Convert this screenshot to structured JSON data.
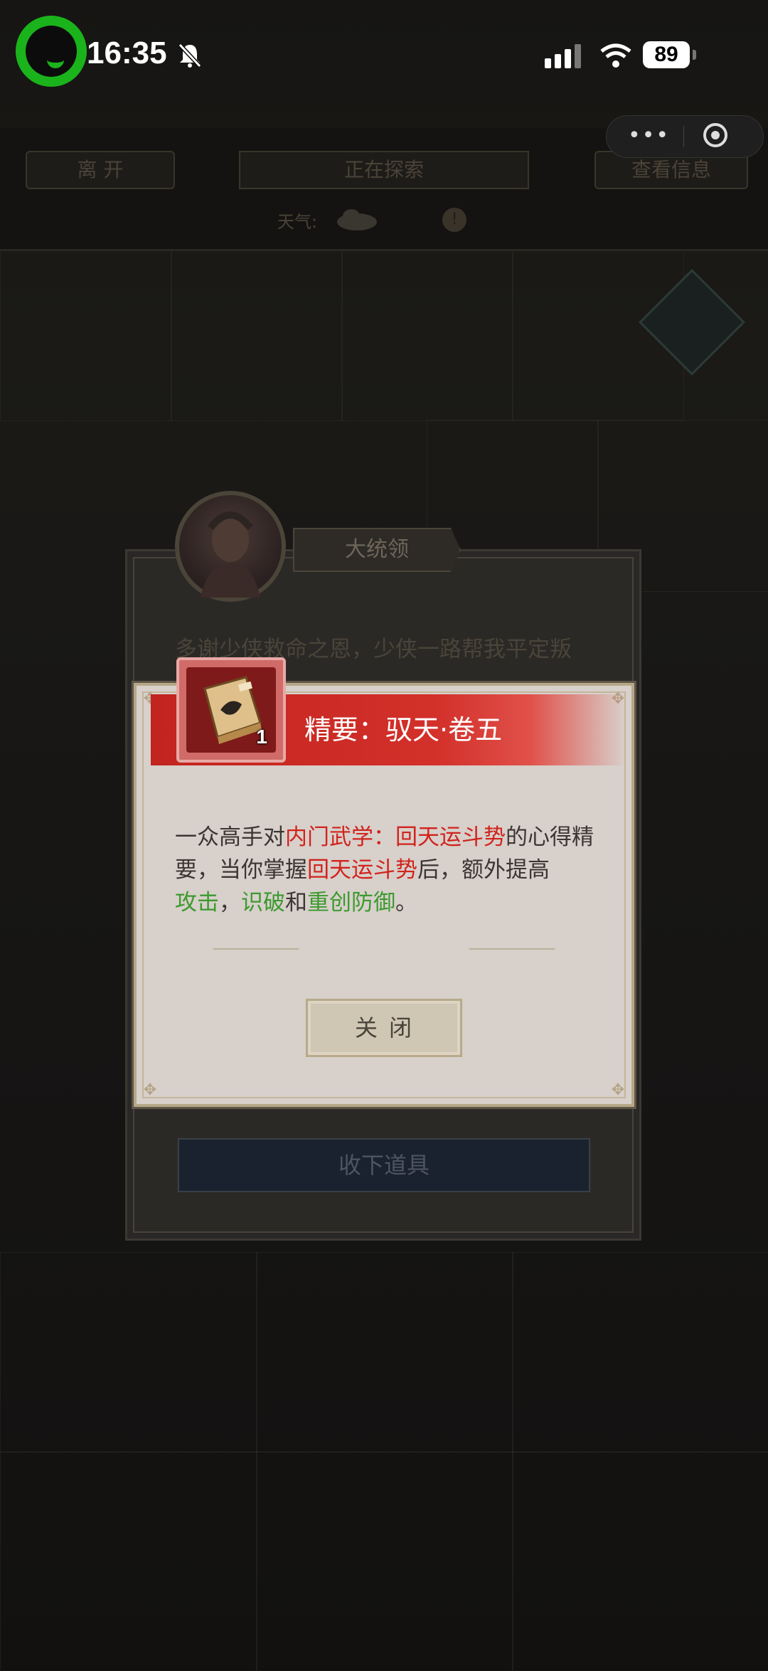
{
  "status_bar": {
    "time": "16:35",
    "battery": "89"
  },
  "top_bar": {
    "leave_label": "离 开",
    "exploring_label": "正在探索",
    "info_label": "查看信息",
    "weather_label": "天气:",
    "weather_info_glyph": "!"
  },
  "npc_dialog": {
    "name": "大统领",
    "text_line1": "多谢少侠救命之恩，少侠一路帮我平定叛",
    "accept_label": "收下道具"
  },
  "item_popup": {
    "title": "精要：驭天·卷五",
    "count": "1",
    "desc": {
      "p1": "一众高手对",
      "h1": "内门武学：回天运斗势",
      "p2": "的心得精要，当你掌握",
      "h2": "回天运斗势",
      "p3": "后，额外提高",
      "g1": "攻击",
      "sep1": "，",
      "g2": "识破",
      "sep2": "和",
      "g3": "重创防御",
      "end": "。"
    },
    "close_label": "关闭"
  },
  "colors": {
    "header_red": "#c2241f",
    "highlight_red": "#d1231d",
    "highlight_green": "#3c9a2e",
    "status_logo_green": "#1bb31b"
  }
}
